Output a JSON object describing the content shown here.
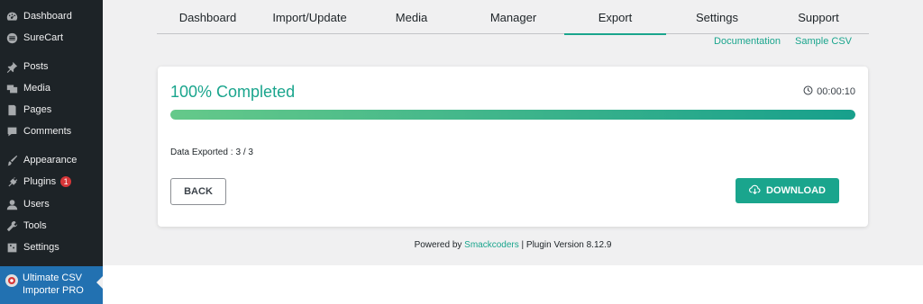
{
  "sidebar": {
    "items": [
      {
        "label": "Dashboard",
        "icon": "dashboard-icon"
      },
      {
        "label": "SureCart",
        "icon": "surecart-icon"
      },
      {
        "label": "Posts",
        "icon": "pin-icon"
      },
      {
        "label": "Media",
        "icon": "media-icon"
      },
      {
        "label": "Pages",
        "icon": "pages-icon"
      },
      {
        "label": "Comments",
        "icon": "comment-icon"
      },
      {
        "label": "Appearance",
        "icon": "brush-icon"
      },
      {
        "label": "Plugins",
        "icon": "plugin-icon",
        "badge": "1"
      },
      {
        "label": "Users",
        "icon": "user-icon"
      },
      {
        "label": "Tools",
        "icon": "wrench-icon"
      },
      {
        "label": "Settings",
        "icon": "settings-icon"
      }
    ],
    "active": {
      "label_line1": "Ultimate CSV",
      "label_line2": "Importer PRO",
      "icon": "csv-importer-icon"
    }
  },
  "tabs": [
    "Dashboard",
    "Import/Update",
    "Media",
    "Manager",
    "Export",
    "Settings",
    "Support"
  ],
  "active_tab": "Export",
  "links": {
    "documentation": "Documentation",
    "sample_csv": "Sample CSV"
  },
  "progress": {
    "title": "100% Completed",
    "timer": "00:00:10",
    "percent": 100,
    "exported_label": "Data Exported :",
    "exported_value": "3 / 3"
  },
  "buttons": {
    "back": "BACK",
    "download": "DOWNLOAD"
  },
  "footer": {
    "prefix": "Powered by",
    "brand": "Smackcoders",
    "suffix": "| Plugin Version 8.12.9"
  },
  "colors": {
    "accent": "#1aa58d",
    "sidebar": "#1d2327",
    "active_menu": "#2271b1",
    "badge": "#d63638"
  }
}
